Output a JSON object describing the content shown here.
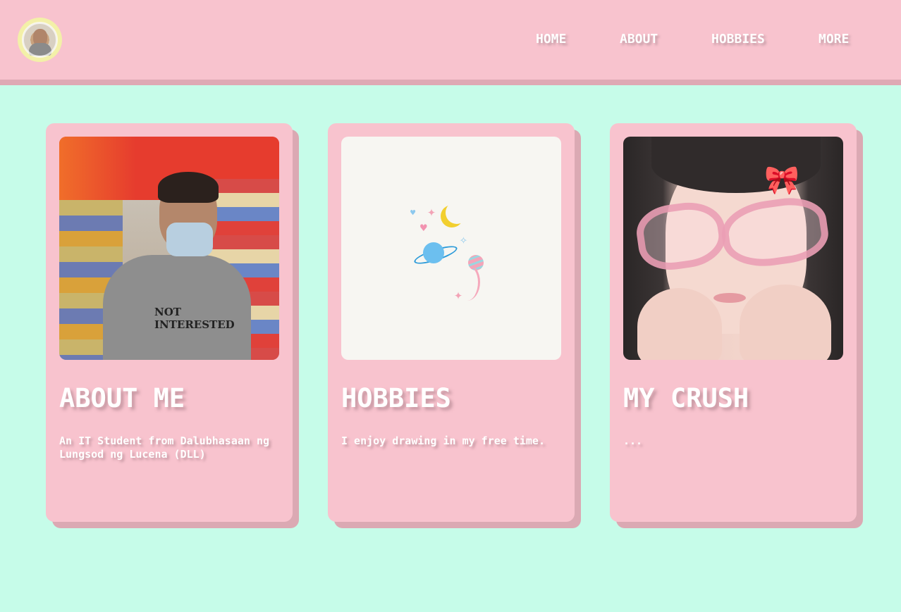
{
  "header": {
    "logo_icon": "profile-avatar-logo",
    "nav": [
      "HOME",
      "ABOUT",
      "HOBBIES",
      "MORE"
    ]
  },
  "cards": [
    {
      "title": "ABOUT ME",
      "text": "An IT Student from Dalubhasaan ng Lungsod ng Lucena (DLL)",
      "image": "photo-person-toy-store",
      "image_caption_text": "NOT INTERESTED"
    },
    {
      "title": "HOBBIES",
      "text": "I enjoy drawing in my free time.",
      "image": "doodle-moon-planet-stars"
    },
    {
      "title": "MY CRUSH",
      "text": "...",
      "image": "photo-girl-pink-glasses-bow"
    }
  ],
  "colors": {
    "background": "#c6fce9",
    "header": "#f8c3ce",
    "card": "#f8c3ce",
    "card_shadow": "#dba9b3",
    "text": "#ffffff"
  }
}
